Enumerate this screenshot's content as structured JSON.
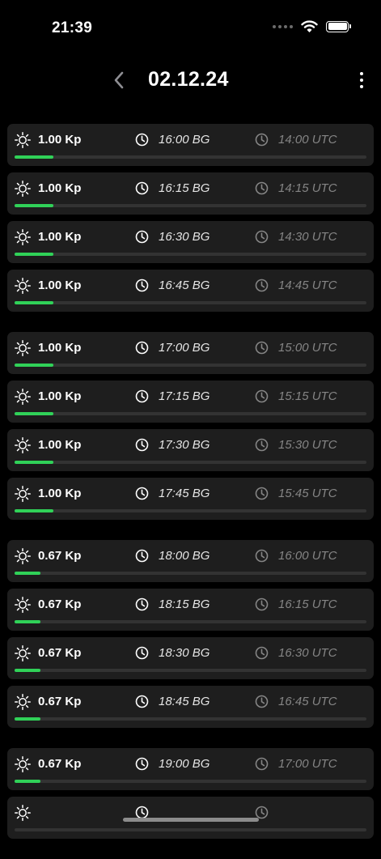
{
  "status_bar": {
    "time": "21:39"
  },
  "header": {
    "title": "02.12.24"
  },
  "colors": {
    "background": "#000000",
    "card": "#1e1e1e",
    "accent": "#30d158",
    "track": "#333333",
    "utc_text": "#858585"
  },
  "icons": {
    "back": "chevron-left-icon",
    "more": "more-vertical-icon",
    "level": "sun-icon",
    "time": "clock-icon"
  },
  "groups": [
    {
      "rows": [
        {
          "kp": "1.00 Kp",
          "bg": "16:00 BG",
          "utc": "14:00 UTC",
          "level": 0.11
        },
        {
          "kp": "1.00 Kp",
          "bg": "16:15 BG",
          "utc": "14:15 UTC",
          "level": 0.11
        },
        {
          "kp": "1.00 Kp",
          "bg": "16:30 BG",
          "utc": "14:30 UTC",
          "level": 0.11
        },
        {
          "kp": "1.00 Kp",
          "bg": "16:45 BG",
          "utc": "14:45 UTC",
          "level": 0.11
        }
      ]
    },
    {
      "rows": [
        {
          "kp": "1.00 Kp",
          "bg": "17:00 BG",
          "utc": "15:00 UTC",
          "level": 0.11
        },
        {
          "kp": "1.00 Kp",
          "bg": "17:15 BG",
          "utc": "15:15 UTC",
          "level": 0.11
        },
        {
          "kp": "1.00 Kp",
          "bg": "17:30 BG",
          "utc": "15:30 UTC",
          "level": 0.11
        },
        {
          "kp": "1.00 Kp",
          "bg": "17:45 BG",
          "utc": "15:45 UTC",
          "level": 0.11
        }
      ]
    },
    {
      "rows": [
        {
          "kp": "0.67 Kp",
          "bg": "18:00 BG",
          "utc": "16:00 UTC",
          "level": 0.074
        },
        {
          "kp": "0.67 Kp",
          "bg": "18:15 BG",
          "utc": "16:15 UTC",
          "level": 0.074
        },
        {
          "kp": "0.67 Kp",
          "bg": "18:30 BG",
          "utc": "16:30 UTC",
          "level": 0.074
        },
        {
          "kp": "0.67 Kp",
          "bg": "18:45 BG",
          "utc": "16:45 UTC",
          "level": 0.074
        }
      ]
    },
    {
      "rows": [
        {
          "kp": "0.67 Kp",
          "bg": "19:00 BG",
          "utc": "17:00 UTC",
          "level": 0.074
        },
        {
          "kp": "",
          "bg": "",
          "utc": "",
          "level": 0
        }
      ]
    }
  ]
}
